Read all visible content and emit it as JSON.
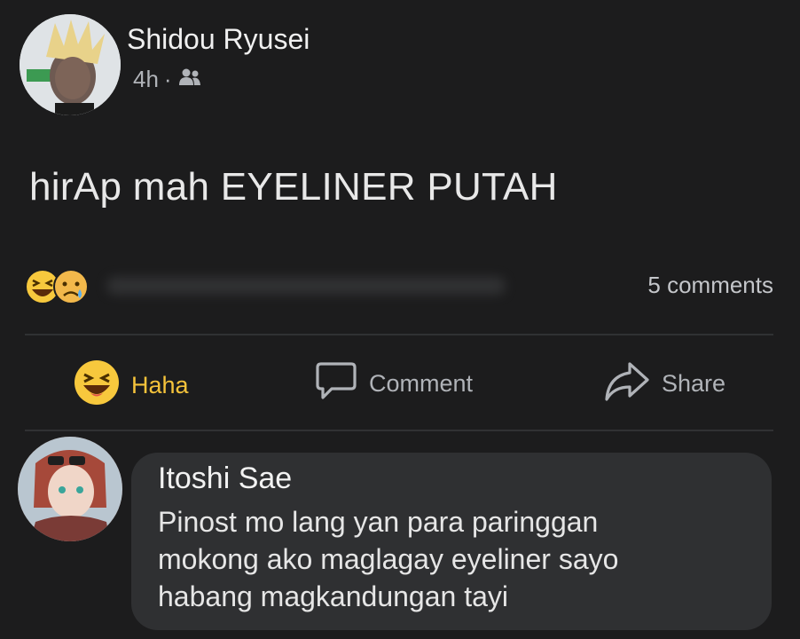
{
  "post": {
    "author_name": "Shidou Ryusei",
    "time": "4h",
    "separator": "·",
    "audience_icon": "friends-icon",
    "text": "hirAp mah EYELINER PUTAH"
  },
  "reactions": {
    "icons": [
      "haha-emoji-icon",
      "sad-emoji-icon"
    ],
    "comments_label": "5 comments"
  },
  "actions": {
    "haha_label": "Haha",
    "comment_label": "Comment",
    "share_label": "Share"
  },
  "comment": {
    "author_name": "Itoshi Sae",
    "lines": [
      "Pinost mo lang yan para paringgan",
      "mokong ako maglagay eyeliner sayo",
      "habang magkandungan tayi"
    ]
  },
  "colors": {
    "background": "#1c1c1d",
    "haha_accent": "#f5c33b",
    "muted_text": "#b0b3b8",
    "bubble": "#2f3032"
  }
}
